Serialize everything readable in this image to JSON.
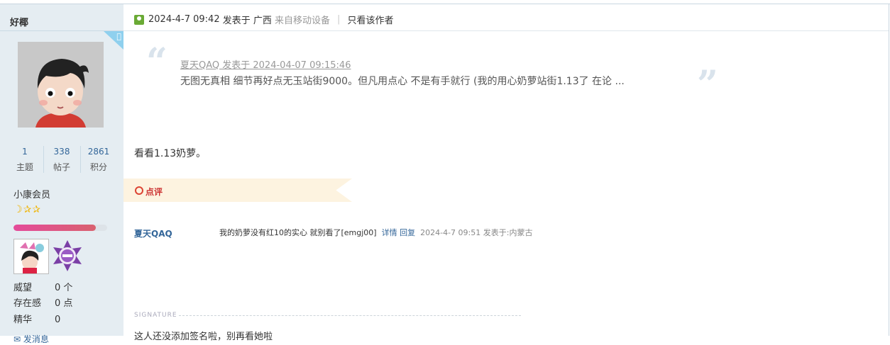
{
  "sidebar": {
    "author": "好椰",
    "corner_icon": "apple-icon",
    "stats": [
      {
        "value": "1",
        "label": "主题"
      },
      {
        "value": "338",
        "label": "帖子"
      },
      {
        "value": "2861",
        "label": "积分"
      }
    ],
    "group": "小康会员",
    "level_progress": 0.88,
    "medals": [
      "cartoon-medal-icon",
      "purple-emblem-icon"
    ],
    "info": [
      {
        "key": "威望",
        "value": "0 个"
      },
      {
        "key": "存在感",
        "value": "0 点"
      },
      {
        "key": "精华",
        "value": "0"
      }
    ],
    "bottom_link": "发消息"
  },
  "post": {
    "timestamp": "2024-4-7 09:42",
    "posted_in": "发表于 广西",
    "device": "来自移动设备",
    "only_author": "只看该作者",
    "quote": {
      "meta": "夏天QAQ 发表于 2024-04-07 09:15:46",
      "text": "无图无真相 细节再好点无玉站街9000。但凡用点心 不是有手就行   (我的用心奶萝站街1.13了 在论 ..."
    },
    "body": "看看1.13奶萝。",
    "review_label": "点评",
    "comment": {
      "author": "夏天QAQ",
      "text": "我的奶萝没有红10的实心 就别看了[emgj00]",
      "detail": "详情",
      "reply": "回复",
      "time": "2024-4-7 09:51 发表于:内蒙古"
    },
    "signature_label": "SIGNATURE",
    "signature": "这人还没添加签名啦，别再看她啦"
  },
  "colors": {
    "sidebar_bg": "#e5edf2",
    "link": "#336699",
    "review_red": "#cc3333",
    "ribbon_bg": "#fdf3e0"
  }
}
